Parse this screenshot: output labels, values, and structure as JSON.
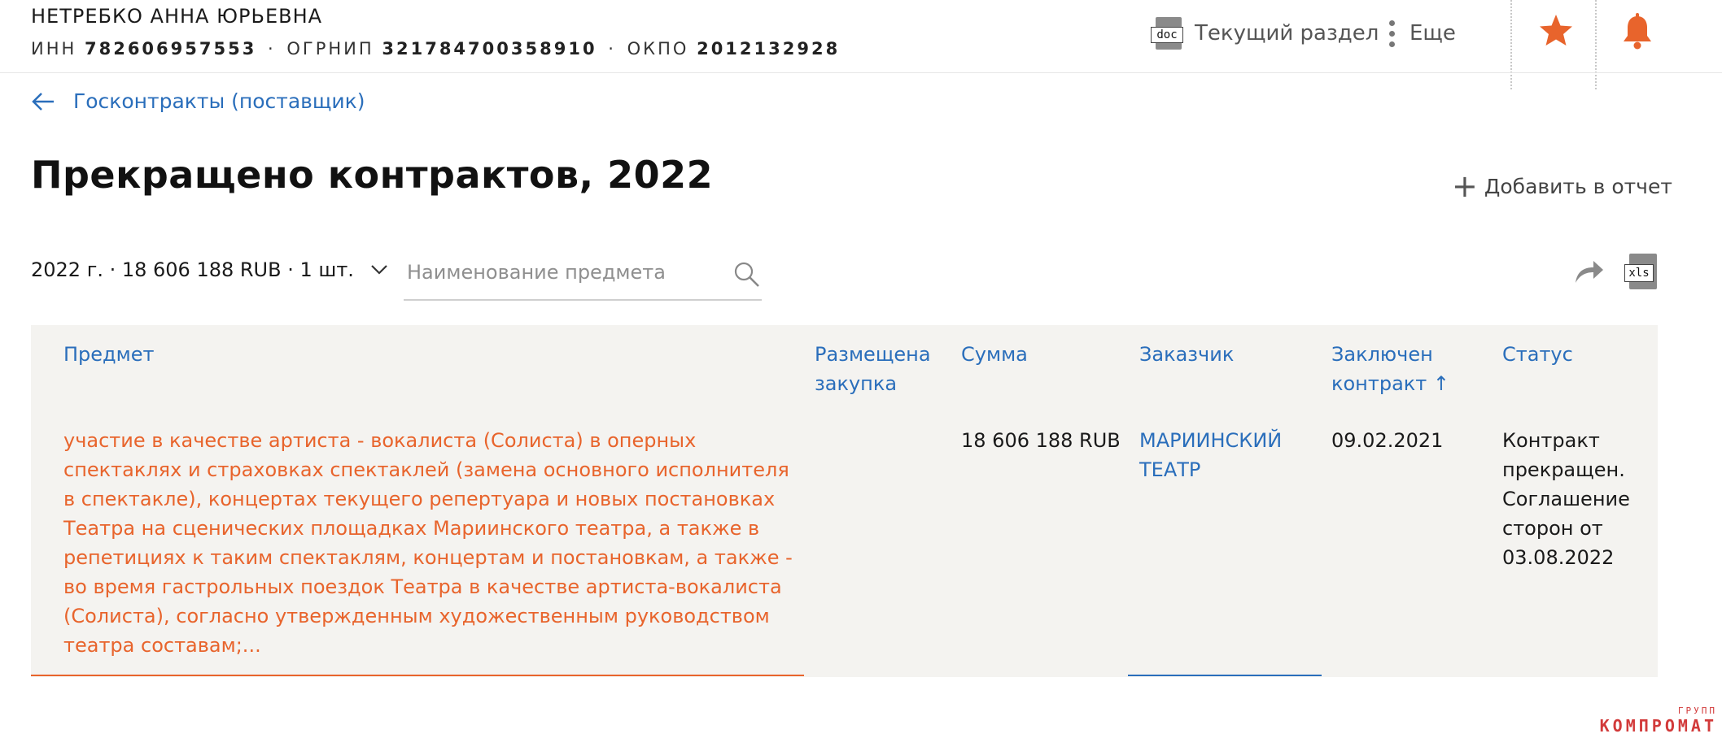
{
  "header": {
    "name": "НЕТРЕБКО АННА ЮРЬЕВНА",
    "inn_label": "ИНН",
    "inn": "782606957553",
    "ogrnip_label": "ОГРНИП",
    "ogrnip": "321784700358910",
    "okpo_label": "ОКПО",
    "okpo": "2012132928",
    "separator": "·",
    "current_section_label": "Текущий раздел",
    "current_section_icon": "doc-icon",
    "current_section_icon_text": "doc",
    "more_label": "Еще",
    "favorite_icon": "star-icon",
    "notify_icon": "bell-icon"
  },
  "back": {
    "label": "Госконтракты (поставщик)",
    "icon": "arrow-left-icon"
  },
  "page": {
    "title": "Прекращено контрактов, 2022",
    "add_to_report_label": "Добавить в отчет"
  },
  "filter": {
    "summary": "2022 г. · 18 606 188 RUB · 1 шт.",
    "search_placeholder": "Наименование предмета",
    "export_icon_text": "xls"
  },
  "table": {
    "columns": {
      "subject": "Предмет",
      "placed_line1": "Размещена",
      "placed_line2": "закупка",
      "sum": "Сумма",
      "customer": "Заказчик",
      "concluded_line1": "Заключен",
      "concluded_line2": "контракт ↑",
      "status": "Статус"
    },
    "rows": [
      {
        "subject": "участие в качестве артиста - вокалиста (Солиста) в оперных спектаклях и страховках спектаклей (замена основного исполнителя в спектакле), концертах текущего репертуара и новых постановках Театра на сценических площадках Мариинского театра, а также в репетициях к таким спектаклям, концертам и постановкам, а также - во время гастрольных поездок Театра в качестве артиста-вокалиста (Солиста), согласно утвержденным художественным руководством театра составам;...",
        "placed": "",
        "sum": "18 606 188 RUB",
        "customer": "МАРИИНСКИЙ ТЕАТР",
        "concluded": "09.02.2021",
        "status": "Контракт прекращен. Соглашение сторон от 03.08.2022"
      }
    ]
  },
  "watermark": {
    "small": "ГРУПП",
    "big": "КОМПРОМАТ"
  },
  "colors": {
    "accent_orange": "#e8642c",
    "link_blue": "#2a6ebb",
    "table_bg": "#f4f3f0"
  }
}
